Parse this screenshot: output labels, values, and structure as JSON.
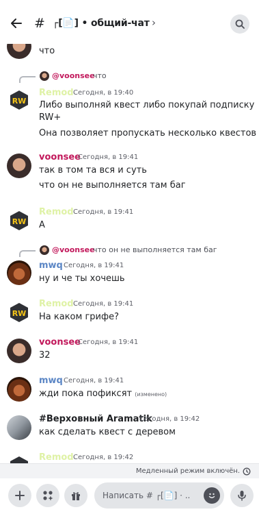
{
  "header": {
    "hash": "#",
    "channel_name": "┌[📄] • общий-чат",
    "chevron": "›"
  },
  "messages": {
    "m0": {
      "text": "что"
    },
    "r1": {
      "name": "@voonsee",
      "text": "что"
    },
    "m1": {
      "author": "Remod",
      "time": "Сегодня, в 19:40",
      "line1": "Либо выполняй квест либо покупай подписку",
      "line2": "RW+",
      "line3": "Она позволяет пропускать несколько квестов"
    },
    "m2": {
      "author": "voonsee",
      "time": "Сегодня, в 19:41",
      "line1": "так в том та вся и суть",
      "line2": "что он не выполняется там баг"
    },
    "m3": {
      "author": "Remod",
      "time": "Сегодня, в 19:41",
      "line1": "А"
    },
    "r4": {
      "name": "@voonsee",
      "text": "что он не выполняется там баг"
    },
    "m4": {
      "author": "mwq",
      "time": "Сегодня, в 19:41",
      "line1": "ну и че ты хочешь"
    },
    "m5": {
      "author": "Remod",
      "time": "Сегодня, в 19:41",
      "line1": "На каком грифе?"
    },
    "m6": {
      "author": "voonsee",
      "time": "Сегодня, в 19:41",
      "line1": "32"
    },
    "m7": {
      "author": "mwq",
      "time": "Сегодня, в 19:41",
      "line1": "жди пока пофиксят",
      "edited": "(изменено)"
    },
    "m8": {
      "author": "#Верховный Aramatik",
      "time": "Сегодня, в 19:42",
      "line1": "как сделать квест с деревом"
    },
    "m9": {
      "author": "Remod",
      "time": "Сегодня, в 19:42"
    }
  },
  "slowmode": {
    "text": "Медленный режим включён."
  },
  "composer": {
    "placeholder": "Написать # ┌[📄] · .."
  },
  "colors": {
    "voonsee": "#c2185b",
    "remod": "#dff2a6",
    "mwq": "#5b86c5",
    "accent": "#5865f2"
  },
  "icons": [
    "back-arrow-icon",
    "hash-icon",
    "search-icon",
    "plus-icon",
    "apps-icon",
    "gift-icon",
    "emoji-icon",
    "mic-icon",
    "clock-icon",
    "rw-logo-icon"
  ]
}
